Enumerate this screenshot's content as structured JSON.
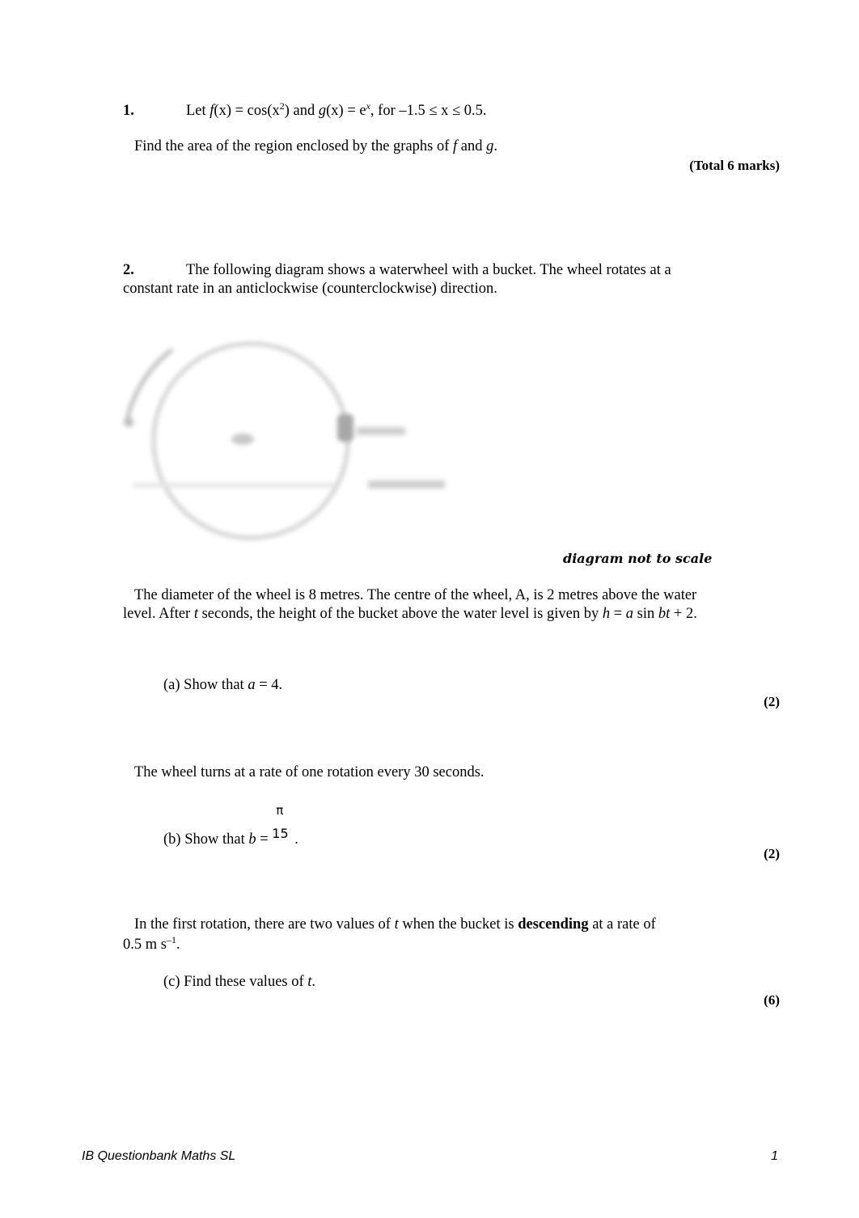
{
  "q1": {
    "number": "1.",
    "stem_a": "Let ",
    "f": "f",
    "x1": "(x) = cos(x",
    "sq": "2",
    "and_g": ") and ",
    "g": "g",
    "x2": "(x) = e",
    "exp": "x",
    "domain": ", for –1.5 ≤ x ≤ 0.5.",
    "task_a": "Find the area of the region enclosed by the graphs of ",
    "task_f": "f",
    "task_and": " and ",
    "task_g": "g",
    "task_end": ".",
    "total": "(Total 6 marks)"
  },
  "q2": {
    "number": "2.",
    "intro_line1": "The following diagram shows a waterwheel with a bucket. The wheel rotates at a",
    "intro_line2": "constant rate in an anticlockwise (counterclockwise) direction.",
    "diagram": {
      "centre_label": "A",
      "bucket_label": "bucket",
      "water_label": "water level",
      "caption": "diagram not to scale"
    },
    "info_line1": "The diameter of the wheel is 8 metres. The centre of the wheel, A, is 2 metres above the water",
    "info_line2_a": "level. After ",
    "info_t": "t",
    "info_line2_b": " seconds, the height of the bucket above the water level is given by ",
    "info_h": "h",
    "info_eq1": " = ",
    "info_a": "a",
    "info_sin": " sin ",
    "info_bt": "bt",
    "info_plus": " + 2.",
    "part_a": {
      "pre": "(a) Show that ",
      "var": "a",
      "post": " = 4.",
      "marks": "(2)"
    },
    "rate_text": "The wheel turns at a rate of one rotation every 30 seconds.",
    "part_b": {
      "pre": "(b) Show that ",
      "var": "b",
      "eq": " = ",
      "num": "π",
      "den": "15",
      "post": ".",
      "marks": "(2)"
    },
    "desc_line1_a": "In the first rotation, there are two values of ",
    "desc_t": "t",
    "desc_line1_b": " when the bucket is ",
    "desc_bold": "descending",
    "desc_line1_c": " at a rate of",
    "desc_line2": "0.5 m s",
    "desc_exp": "–1",
    "desc_end": ".",
    "part_c": {
      "pre": "(c) Find these values of ",
      "var": "t",
      "post": ".",
      "marks": "(6)"
    }
  },
  "footer": {
    "left": "IB Questionbank Maths SL",
    "page": "1"
  }
}
